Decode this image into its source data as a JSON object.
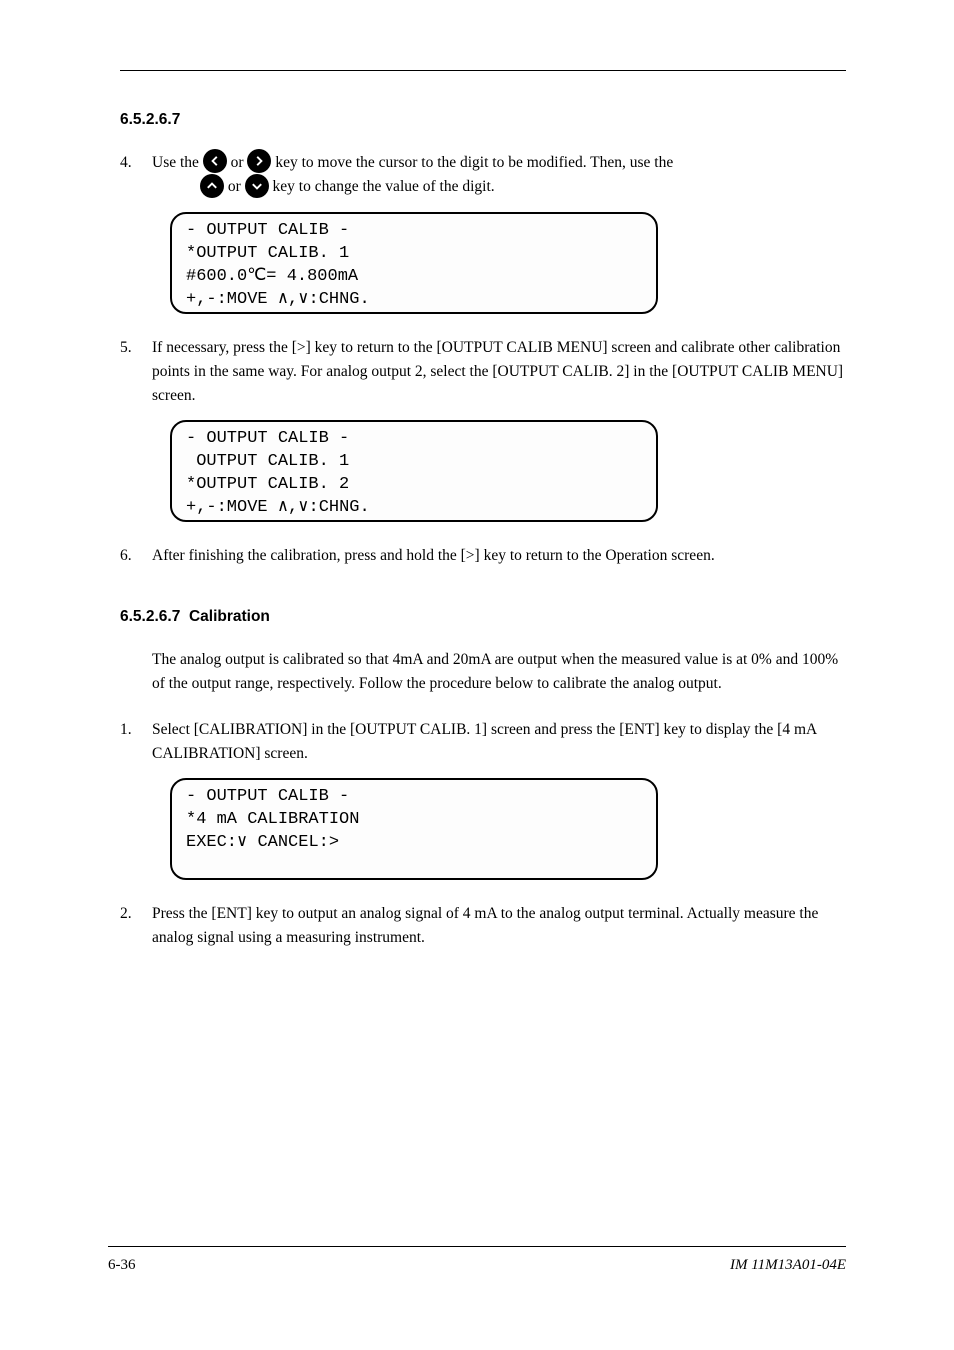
{
  "section_number": "6.5.2.6.7",
  "para1": {
    "num": "4.",
    "part1": "Use the ",
    "or1": " or ",
    "part2": " key to move the cursor to the digit to be modified. Then, use the ",
    "or2": " or ",
    "part3": " key to change the value of the digit."
  },
  "lcd1": {
    "l1": "- OUTPUT CALIB -",
    "l2": "*OUTPUT CALIB. 1",
    "l3": "#600.0℃= 4.800mA",
    "l4": "+,-:MOVE ∧,∨:CHNG."
  },
  "para2": {
    "num": "5.",
    "text": "If necessary, press the [>] key to return to the [OUTPUT CALIB MENU] screen and calibrate other calibration points in the same way. For analog output 2, select the [OUTPUT CALIB. 2] in the [OUTPUT CALIB MENU] screen."
  },
  "lcd2": {
    "l1": "- OUTPUT CALIB -",
    "l2": " OUTPUT CALIB. 1",
    "l3": "*OUTPUT CALIB. 2",
    "l4": "+,-:MOVE ∧,∨:CHNG."
  },
  "para3": {
    "num": "6.",
    "text": "After finishing the calibration, press and hold the [>] key to return to the Operation screen."
  },
  "section2_number": "6.5.2.6.7",
  "section2_title": "Calibration",
  "section2_para1": "The analog output is calibrated so that 4mA and 20mA are output when the measured value is at 0% and 100% of the output range, respectively. Follow the procedure below to calibrate the analog output.",
  "section2_para2": {
    "num": "1.",
    "text": "Select [CALIBRATION] in the [OUTPUT CALIB. 1] screen and press the [ENT] key to display the [4 mA CALIBRATION] screen."
  },
  "lcd3": {
    "l1": "- OUTPUT CALIB -",
    "l2": "*4 mA CALIBRATION",
    "l3": "",
    "l4": "EXEC:∨ CANCEL:>"
  },
  "section2_para3": {
    "num": "2.",
    "text": "Press the [ENT] key to output an analog signal of 4 mA to the analog output terminal. Actually measure the analog signal using a measuring instrument."
  },
  "footer": {
    "left": "6-36",
    "right": "IM 11M13A01-04E"
  }
}
